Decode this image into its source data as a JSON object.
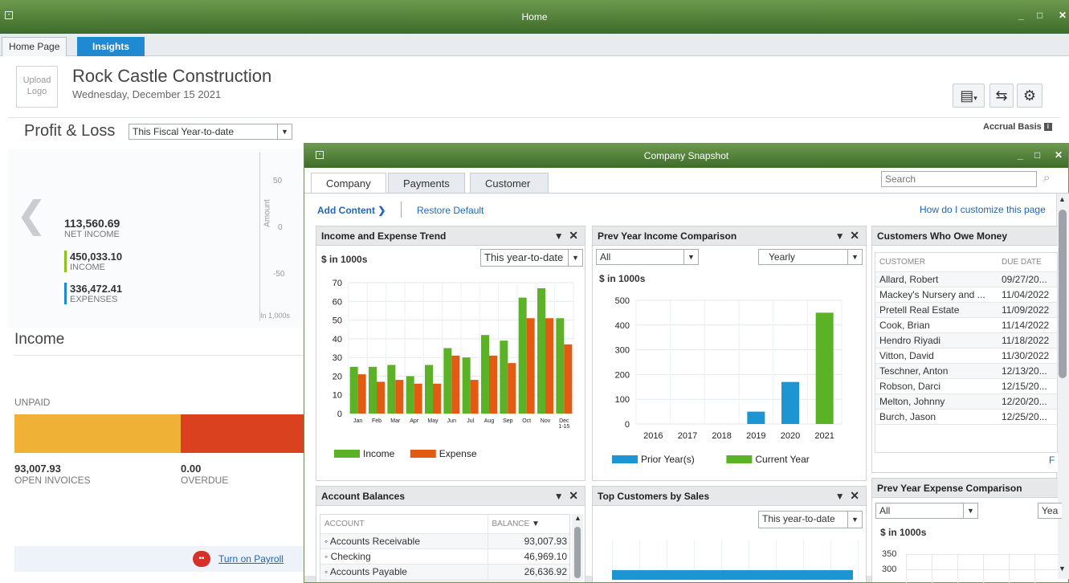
{
  "window": {
    "title": "Home",
    "minimize": "_",
    "maximize": "□",
    "close": "✕"
  },
  "tabs": [
    {
      "label": "Home Page"
    },
    {
      "label": "Insights"
    }
  ],
  "header": {
    "logo_text": "Upload Logo",
    "company_name": "Rock Castle Construction",
    "date": "Wednesday, December 15 2021"
  },
  "profit_loss": {
    "title": "Profit & Loss",
    "period": "This Fiscal Year-to-date",
    "basis": "Accrual Basis",
    "net_income": "113,560.69",
    "net_income_label": "NET INCOME",
    "income": "450,033.10",
    "income_label": "INCOME",
    "expenses": "336,472.41",
    "expenses_label": "EXPENSES",
    "axis_label": "Amount",
    "axis_ticks": [
      "50",
      "0",
      "-50"
    ],
    "unit": "In 1,000s",
    "income_color": "#8dc21f",
    "expense_color": "#1f8ad1"
  },
  "income_section": {
    "title": "Income",
    "unpaid_label": "UNPAID",
    "open_invoices": "93,007.93",
    "open_invoices_label": "OPEN INVOICES",
    "overdue": "0.00",
    "overdue_label": "OVERDUE",
    "payroll_link": "Turn on Payroll",
    "open_color": "#f0b236",
    "overdue_color": "#d9411f"
  },
  "snapshot": {
    "title": "Company Snapshot",
    "tabs": [
      "Company",
      "Payments",
      "Customer"
    ],
    "search_placeholder": "Search",
    "add_content": "Add Content",
    "restore_default": "Restore Default",
    "customize_link": "How do I customize this page"
  },
  "income_expense_trend": {
    "title": "Income and Expense Trend",
    "unit_label": "$ in 1000s",
    "period": "This year-to-date",
    "legend": [
      "Income",
      "Expense"
    ]
  },
  "prev_year_income": {
    "title": "Prev Year Income Comparison",
    "filter": "All",
    "period": "Yearly",
    "unit_label": "$ in 1000s",
    "legend": [
      "Prior Year(s)",
      "Current Year"
    ]
  },
  "customers_owe": {
    "title": "Customers Who Owe Money",
    "columns": [
      "CUSTOMER",
      "DUE DATE"
    ],
    "rows": [
      [
        "Allard, Robert",
        "09/27/20..."
      ],
      [
        "Mackey's Nursery and ...",
        "11/04/2022"
      ],
      [
        "Pretell Real Estate",
        "11/09/2022"
      ],
      [
        "Cook, Brian",
        "11/14/2022"
      ],
      [
        "Hendro Riyadi",
        "11/18/2022"
      ],
      [
        "Vitton, David",
        "11/30/2022"
      ],
      [
        "Teschner, Anton",
        "12/13/20..."
      ],
      [
        "Robson, Darci",
        "12/15/20..."
      ],
      [
        "Melton, Johnny",
        "12/20/20..."
      ],
      [
        "Burch, Jason",
        "12/25/20..."
      ]
    ],
    "footer_link": "F"
  },
  "account_balances": {
    "title": "Account Balances",
    "columns": [
      "ACCOUNT",
      "BALANCE"
    ],
    "rows": [
      [
        "Accounts Receivable",
        "93,007.93"
      ],
      [
        "Checking",
        "46,969.10"
      ],
      [
        "Accounts Payable",
        "26,636.92"
      ]
    ]
  },
  "top_customers": {
    "title": "Top Customers by Sales",
    "period": "This year-to-date"
  },
  "prev_year_expense": {
    "title": "Prev Year Expense Comparison",
    "filter": "All",
    "period": "Yea",
    "unit_label": "$ in 1000s",
    "ticks": [
      "350",
      "300"
    ]
  },
  "chart_data": [
    {
      "type": "bar",
      "title": "Income and Expense Trend",
      "ylabel": "$ in 1000s",
      "categories": [
        "Jan",
        "Feb",
        "Mar",
        "Apr",
        "May",
        "Jun",
        "Jul",
        "Aug",
        "Sep",
        "Oct",
        "Nov",
        "Dec 1-15"
      ],
      "series": [
        {
          "name": "Income",
          "values": [
            25,
            25,
            26,
            20,
            26,
            35,
            30,
            42,
            39,
            62,
            67,
            51
          ],
          "color": "#5bb226"
        },
        {
          "name": "Expense",
          "values": [
            21,
            17,
            18,
            16,
            16,
            31,
            18,
            31,
            27,
            51,
            51,
            37
          ],
          "color": "#e35a12"
        }
      ],
      "ylim": [
        0,
        70
      ],
      "yticks": [
        0,
        10,
        20,
        30,
        40,
        50,
        60,
        70
      ],
      "grid": true,
      "legend": "bottom"
    },
    {
      "type": "bar",
      "title": "Prev Year Income Comparison",
      "ylabel": "$ in 1000s",
      "categories": [
        "2016",
        "2017",
        "2018",
        "2019",
        "2020",
        "2021"
      ],
      "series": [
        {
          "name": "Prior Year(s)",
          "values": [
            0,
            0,
            0,
            50,
            170,
            0
          ],
          "color": "#1c95d2"
        },
        {
          "name": "Current Year",
          "values": [
            0,
            0,
            0,
            0,
            0,
            450
          ],
          "color": "#5bb226"
        }
      ],
      "ylim": [
        0,
        500
      ],
      "yticks": [
        0,
        100,
        200,
        300,
        400,
        500
      ],
      "grid": true,
      "legend": "bottom"
    }
  ]
}
